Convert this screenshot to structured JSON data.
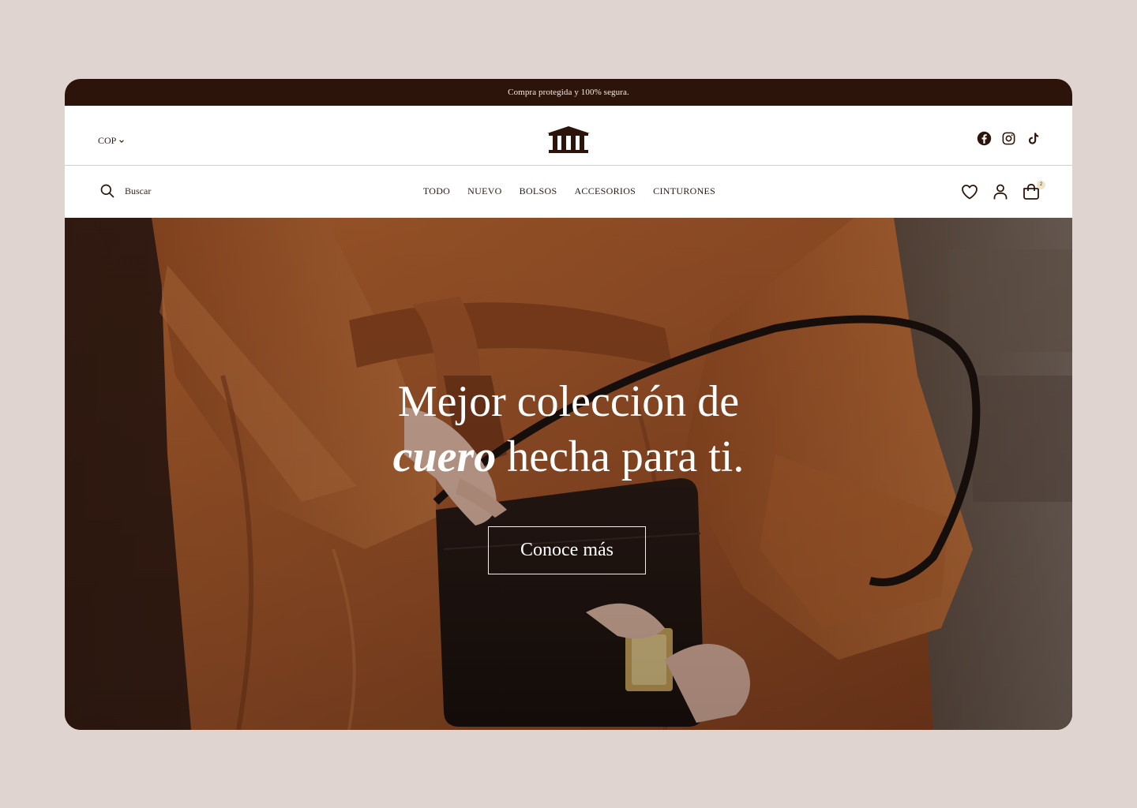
{
  "announcement": {
    "text": "Compra protegida y 100% segura."
  },
  "header": {
    "currency": "COP",
    "logo_icon": "temple-columns-icon",
    "social": [
      {
        "name": "facebook",
        "icon": "facebook-icon"
      },
      {
        "name": "instagram",
        "icon": "instagram-icon"
      },
      {
        "name": "tiktok",
        "icon": "tiktok-icon"
      }
    ]
  },
  "nav": {
    "search_placeholder": "Buscar",
    "menu": [
      "TODO",
      "NUEVO",
      "BOLSOS",
      "ACCESORIOS",
      "CINTURONES"
    ],
    "actions": [
      {
        "name": "wishlist",
        "icon": "heart-icon"
      },
      {
        "name": "account",
        "icon": "user-icon"
      },
      {
        "name": "cart",
        "icon": "shopping-bag-icon",
        "count": "2"
      }
    ]
  },
  "hero": {
    "title_line1": "Mejor colección de",
    "title_em": "cuero",
    "title_line2_rest": " hecha para ti.",
    "button_label": "Conoce más"
  },
  "colors": {
    "announcement_bg": "#2c140a",
    "page_bg": "#dfd4cf",
    "text": "#2b1a12",
    "hero_leather": "#a85a2e"
  }
}
